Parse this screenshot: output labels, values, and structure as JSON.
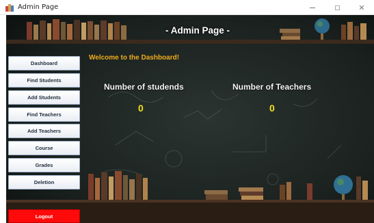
{
  "window": {
    "title": "Admin Page",
    "controls": {
      "minimize": "–",
      "maximize": "□",
      "close": "✕"
    }
  },
  "header": {
    "title": "- Admin Page -"
  },
  "sidebar": {
    "items": [
      {
        "label": "Dashboard"
      },
      {
        "label": "Find Students"
      },
      {
        "label": "Add Students"
      },
      {
        "label": "Find Teachers"
      },
      {
        "label": "Add Teachers"
      },
      {
        "label": "Course"
      },
      {
        "label": "Grades"
      },
      {
        "label": "Deletion"
      }
    ],
    "logout": "Logout"
  },
  "dashboard": {
    "welcome": "Welcome to the Dashboard!",
    "students_label": "Number of studends",
    "students_count": "0",
    "teachers_label": "Number of Teachers",
    "teachers_count": "0"
  },
  "colors": {
    "accent_welcome": "#f0ac1c",
    "count_color": "#f5e11a",
    "logout_bg": "#ff0a0a",
    "background": "#151b19"
  },
  "icons": {
    "app": "bar-chart-icon",
    "minimize": "minimize-icon",
    "maximize": "maximize-icon",
    "close": "close-icon"
  }
}
